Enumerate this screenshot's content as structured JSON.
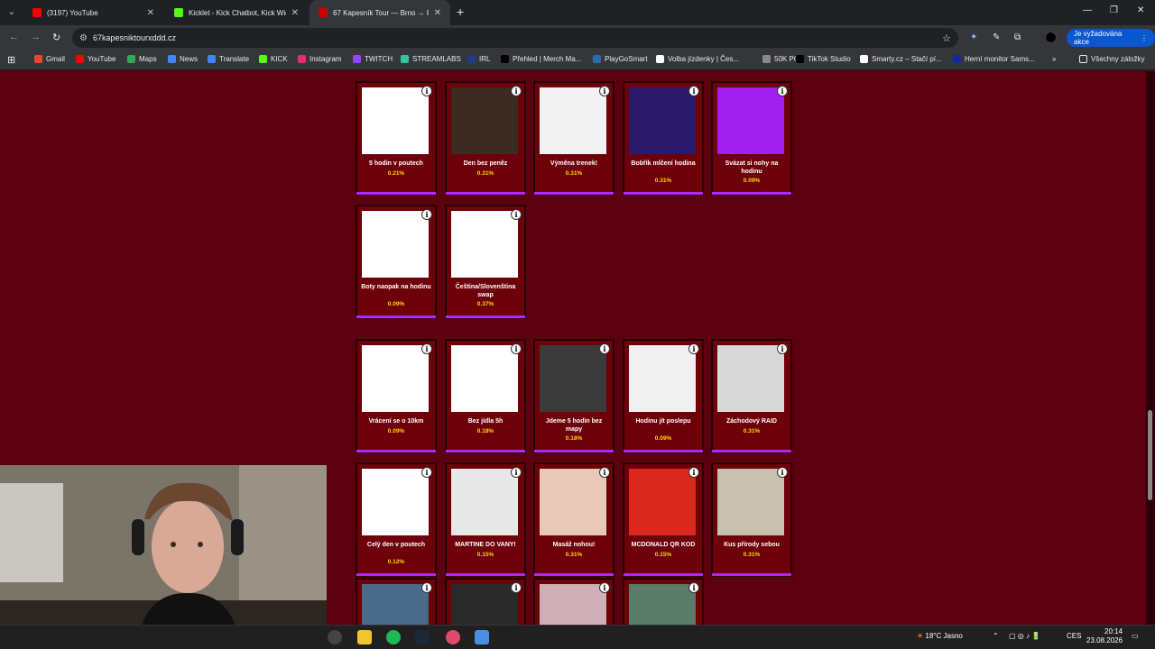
{
  "browser": {
    "tabs": [
      {
        "title": "(3197) YouTube",
        "color": "#ff0000"
      },
      {
        "title": "Kicklet - Kick Chatbot, Kick Wid",
        "color": "#53fc18"
      },
      {
        "title": "67 Kapesník Tour — Brno → Pr",
        "color": "#cc0000"
      }
    ],
    "url": "67kapesniktourxddd.cz",
    "action_label": "Je vyžadována akce",
    "bookmarks": [
      {
        "label": "Gmail",
        "color": "#ea4335"
      },
      {
        "label": "YouTube",
        "color": "#ff0000"
      },
      {
        "label": "Maps",
        "color": "#34a853"
      },
      {
        "label": "News",
        "color": "#4285f4"
      },
      {
        "label": "Translate",
        "color": "#4285f4"
      },
      {
        "label": "KICK",
        "color": "#53fc18"
      },
      {
        "label": "Instagram",
        "color": "#e1306c"
      },
      {
        "label": "TWITCH",
        "color": "#9146ff"
      },
      {
        "label": "STREAMLABS",
        "color": "#31c3a2"
      },
      {
        "label": "IRL",
        "color": "#1f3b8a"
      },
      {
        "label": "Přehled | Merch Ma...",
        "color": "#000000"
      },
      {
        "label": "PlayGoSmart",
        "color": "#2b6cb0"
      },
      {
        "label": "Volba jízdenky | Čes...",
        "color": "#ffffff"
      },
      {
        "label": "50K PC",
        "color": "#888888"
      },
      {
        "label": "TikTok Studio",
        "color": "#000000"
      },
      {
        "label": "Smarty.cz – Stačí pí...",
        "color": "#ffffff"
      },
      {
        "label": "Herní monitor Sams...",
        "color": "#1428a0"
      }
    ],
    "all_bookmarks": "Všechny záložky"
  },
  "cards": [
    {
      "name": "5 hodin v poutech",
      "pct": "0.21%",
      "icon": "handcuffs-image",
      "bg": "#ffffff"
    },
    {
      "name": "Den bez peněz",
      "pct": "0.31%",
      "icon": "empty-wallet-image",
      "bg": "#3a2a20"
    },
    {
      "name": "Výměna trenek!",
      "pct": "0.31%",
      "icon": "underwear-swap-image",
      "bg": "#f2f2f2"
    },
    {
      "name": "Bobřík mlčení hodina",
      "pct": "0.31%",
      "icon": "silent-dog-image",
      "bg": "#2a1a6b"
    },
    {
      "name": "Svázat si nohy na hodinu",
      "pct": "0.09%",
      "icon": "tied-legs-image",
      "bg": "#a020f0"
    },
    {
      "name": "Boty naopak na hodinu",
      "pct": "0.09%",
      "icon": "shoes-swap-image",
      "bg": "#ffffff"
    },
    {
      "name": "Čeština/Slovenština swap",
      "pct": "0.37%",
      "icon": "cz-sk-swap-image",
      "bg": "#ffffff"
    },
    {
      "name": "Vrácení se o 10km",
      "pct": "0.09%",
      "icon": "10km-back-image",
      "bg": "#ffffff"
    },
    {
      "name": "Bez jídla 5h",
      "pct": "0.18%",
      "icon": "no-food-image",
      "bg": "#ffffff"
    },
    {
      "name": "Jdeme 5 hodin bez mapy",
      "pct": "0.18%",
      "icon": "no-map-image",
      "bg": "#3a3a3a"
    },
    {
      "name": "Hodinu jít poslepu",
      "pct": "0.09%",
      "icon": "blindfold-image",
      "bg": "#f0f0f0"
    },
    {
      "name": "Záchodový RAID",
      "pct": "0.31%",
      "icon": "toilet-image",
      "bg": "#d8d8d8"
    },
    {
      "name": "Celý den v poutech",
      "pct": "0.12%",
      "icon": "handcuffs-image",
      "bg": "#ffffff"
    },
    {
      "name": "MARTINE DO VANY!",
      "pct": "0.15%",
      "icon": "bathtub-image",
      "bg": "#e8e8e8"
    },
    {
      "name": "Masáž nohou!",
      "pct": "0.31%",
      "icon": "foot-massage-image",
      "bg": "#e8c8b8"
    },
    {
      "name": "MCDONALD QR KOD",
      "pct": "0.15%",
      "icon": "mcdonalds-image",
      "bg": "#da291c"
    },
    {
      "name": "Kus přírody sebou",
      "pct": "0.31%",
      "icon": "boulder-image",
      "bg": "#c8c0b0"
    },
    {
      "name": "",
      "pct": "",
      "icon": "bus-image",
      "bg": "#4a6a8a"
    },
    {
      "name": "",
      "pct": "",
      "icon": "person-image",
      "bg": "#2a2a2a"
    },
    {
      "name": "",
      "pct": "",
      "icon": "bunny-ears-image",
      "bg": "#d0b0b8"
    },
    {
      "name": "",
      "pct": "",
      "icon": "green-texture-image",
      "bg": "#5a7a6a"
    }
  ],
  "taskbar": {
    "weather": "18°C  Jasno",
    "lang": "CES",
    "time": "20:14",
    "date": "23.08.2026"
  }
}
